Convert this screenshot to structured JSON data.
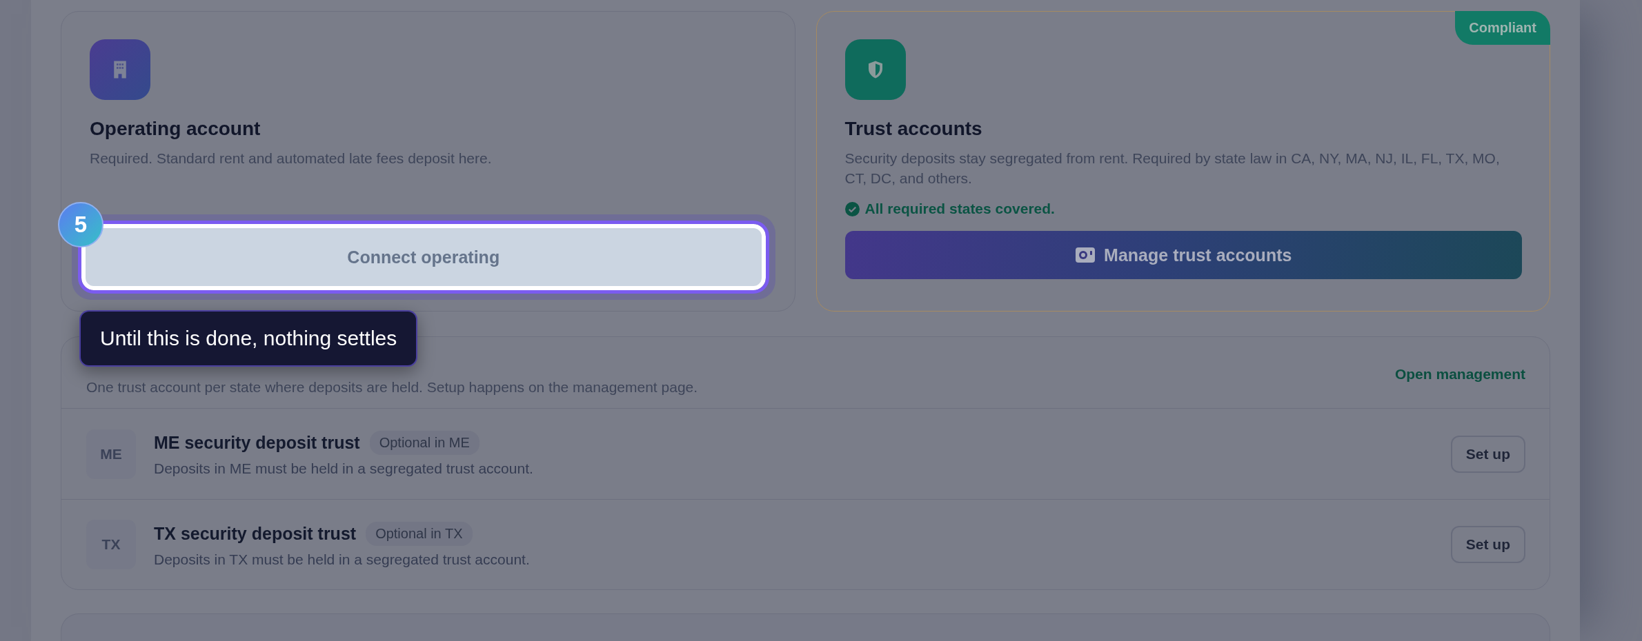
{
  "operating_card": {
    "title": "Operating account",
    "description": "Required. Standard rent and automated late fees deposit here.",
    "button": {
      "label": "Connect operating"
    },
    "step_badge": "5"
  },
  "tooltip": {
    "text": "Until this is done, nothing settles"
  },
  "trust_card": {
    "badge": "Compliant",
    "title": "Trust accounts",
    "description": "Security deposits stay segregated from rent. Required by state law in CA, NY, MA, NJ, IL, FL, TX, MO, CT, DC, and others.",
    "status": "All required states covered.",
    "button": {
      "label": "Manage trust accounts"
    }
  },
  "state_section": {
    "description": "One trust account per state where deposits are held. Setup happens on the management page.",
    "link": "Open management",
    "rows": [
      {
        "code": "ME",
        "title": "ME security deposit trust",
        "tag": "Optional in ME",
        "description": "Deposits in ME must be held in a segregated trust account.",
        "button": "Set up"
      },
      {
        "code": "TX",
        "title": "TX security deposit trust",
        "tag": "Optional in TX",
        "description": "Deposits in TX must be held in a segregated trust account.",
        "button": "Set up"
      }
    ]
  }
}
